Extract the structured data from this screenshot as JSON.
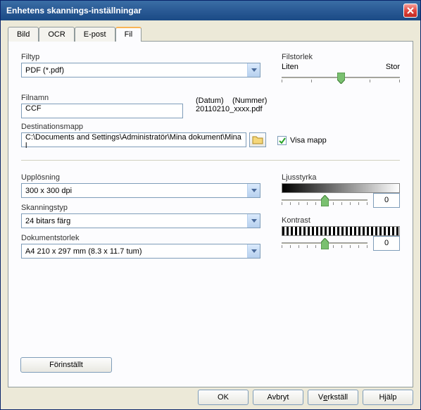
{
  "title": "Enhetens skannings-inställningar",
  "tabs": {
    "bild": "Bild",
    "ocr": "OCR",
    "epost": "E-post",
    "fil": "Fil"
  },
  "labels": {
    "filtyp": "Filtyp",
    "filstorlek": "Filstorlek",
    "liten": "Liten",
    "stor": "Stor",
    "filnamn": "Filnamn",
    "datum": "(Datum)",
    "nummer": "(Nummer)",
    "exempel": "20110210_xxxx.pdf",
    "destmapp": "Destinationsmapp",
    "visamapp": "Visa mapp",
    "upplosning": "Upplösning",
    "skanningstyp": "Skanningstyp",
    "dokumentstorlek": "Dokumentstorlek",
    "ljusstyrka": "Ljusstyrka",
    "kontrast": "Kontrast"
  },
  "values": {
    "filtyp": "PDF (*.pdf)",
    "filnamn": "CCF",
    "destmapp": "C:\\Documents and Settings\\Administratör\\Mina dokument\\Mina l",
    "upplosning": "300 x 300 dpi",
    "skanningstyp": "24 bitars färg",
    "dokumentstorlek": "A4 210 x 297 mm (8.3 x 11.7 tum)",
    "ljusstyrka": "0",
    "kontrast": "0"
  },
  "buttons": {
    "preset": "Förinställt",
    "ok": "OK",
    "avbryt": "Avbryt",
    "verkstall_pre": "V",
    "verkstall_u": "e",
    "verkstall_post": "rkställ",
    "hjalp": "Hjälp"
  }
}
